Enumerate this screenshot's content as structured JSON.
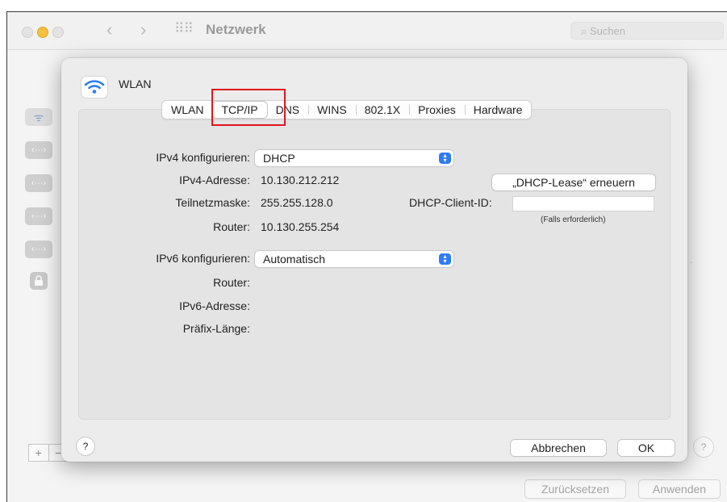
{
  "background_window": {
    "title": "Netzwerk",
    "search_placeholder": "Suchen",
    "nav_back": "‹",
    "nav_forward": "›",
    "grid_glyph": "⠿⠿",
    "plus": "+",
    "minus": "−",
    "help": "?",
    "reset_button": "Zurücksetzen",
    "apply_button": "Anwenden",
    "sidebar_icons": [
      "wifi-icon",
      "ethernet-icon",
      "ethernet-icon",
      "ethernet-icon",
      "ethernet-icon",
      "lock-icon"
    ],
    "sidebar_glyphs": {
      "wifi": "ᯤ",
      "ethernet": "‹···›",
      "lock": "🔒"
    }
  },
  "sheet": {
    "title": "WLAN",
    "tabs": [
      "WLAN",
      "TCP/IP",
      "DNS",
      "WINS",
      "802.1X",
      "Proxies",
      "Hardware"
    ],
    "selected_tab": "TCP/IP",
    "ipv4_configure_label": "IPv4 konfigurieren:",
    "ipv4_configure_value": "DHCP",
    "ipv4_address_label": "IPv4-Adresse:",
    "ipv4_address_value": "10.130.212.212",
    "subnet_label": "Teilnetzmaske:",
    "subnet_value": "255.255.128.0",
    "router_label": "Router:",
    "router_value": "10.130.255.254",
    "renew_button": "„DHCP-Lease“ erneuern",
    "client_id_label": "DHCP-Client-ID:",
    "client_id_value": "",
    "client_id_note": "(Falls erforderlich)",
    "ipv6_configure_label": "IPv6 konfigurieren:",
    "ipv6_configure_value": "Automatisch",
    "ipv6_router_label": "Router:",
    "ipv6_address_label": "IPv6-Adresse:",
    "prefix_label": "Präfix-Länge:",
    "help": "?",
    "cancel_button": "Abbrechen",
    "ok_button": "OK"
  },
  "colors": {
    "accent": "#2d7cf6",
    "highlight": "#e2171b",
    "traffic_yellow": "#f6bf3d"
  }
}
